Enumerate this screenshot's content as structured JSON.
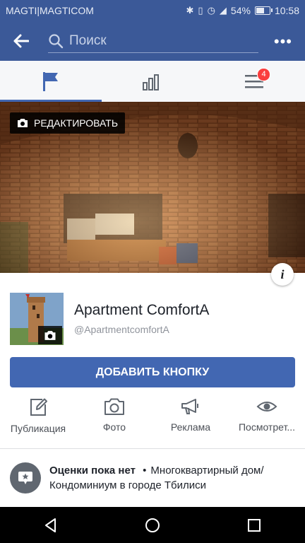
{
  "status_bar": {
    "carrier": "MAGTI|MAGTICOM",
    "battery": "54%",
    "battery_level": 0.54,
    "time": "10:58"
  },
  "top_bar": {
    "search_placeholder": "Поиск"
  },
  "tabs": {
    "notifications_badge": "4"
  },
  "cover": {
    "edit_label": "РЕДАКТИРОВАТЬ"
  },
  "page": {
    "name": "Apartment ComfortA",
    "handle": "@ApartmentcomfortA",
    "add_button_label": "ДОБАВИТЬ КНОПКУ"
  },
  "actions": [
    {
      "label": "Публикация",
      "icon": "edit-icon"
    },
    {
      "label": "Фото",
      "icon": "camera-icon"
    },
    {
      "label": "Реклама",
      "icon": "megaphone-icon"
    },
    {
      "label": "Посмотрет...",
      "icon": "eye-icon"
    }
  ],
  "info": {
    "rating_title": "Оценки пока нет",
    "separator": "•",
    "category": "Многоквартирный дом/Кондоминиум в городе Тбилиси"
  },
  "colors": {
    "brand": "#3b5998",
    "button": "#4267b2",
    "badge": "#fa3e3e"
  }
}
